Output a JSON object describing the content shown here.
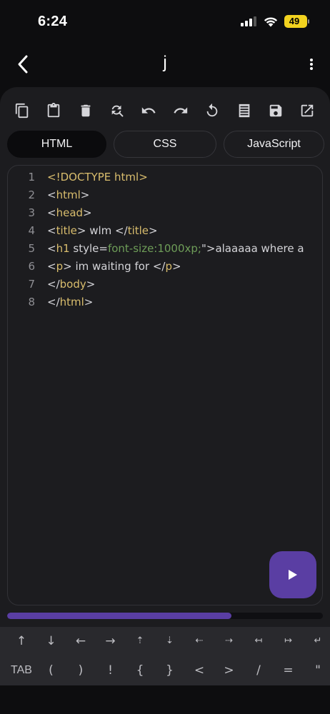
{
  "status_bar": {
    "time": "6:24",
    "battery": "49"
  },
  "header": {
    "title": "j"
  },
  "toolbar": {
    "icons": [
      "copy-icon",
      "paste-icon",
      "delete-icon",
      "find-replace-icon",
      "undo-icon",
      "redo-icon",
      "reload-icon",
      "format-icon",
      "save-icon",
      "open-external-icon"
    ]
  },
  "tabs": [
    {
      "label": "HTML",
      "active": true
    },
    {
      "label": "CSS",
      "active": false
    },
    {
      "label": "JavaScript",
      "active": false
    }
  ],
  "editor": {
    "lines": [
      {
        "n": "1",
        "tokens": [
          {
            "t": "<!DOCTYPE html>",
            "c": "y"
          }
        ]
      },
      {
        "n": "2",
        "tokens": [
          {
            "t": "<",
            "c": "w"
          },
          {
            "t": "html",
            "c": "y"
          },
          {
            "t": ">",
            "c": "w"
          }
        ]
      },
      {
        "n": "3",
        "tokens": [
          {
            "t": "<",
            "c": "w"
          },
          {
            "t": "head",
            "c": "y"
          },
          {
            "t": ">",
            "c": "w"
          }
        ]
      },
      {
        "n": "4",
        "tokens": [
          {
            "t": "<",
            "c": "w"
          },
          {
            "t": "title",
            "c": "y"
          },
          {
            "t": "> wlm </",
            "c": "w"
          },
          {
            "t": "title",
            "c": "y"
          },
          {
            "t": ">",
            "c": "w"
          }
        ]
      },
      {
        "n": "5",
        "tokens": [
          {
            "t": "<",
            "c": "w"
          },
          {
            "t": "h1",
            "c": "y"
          },
          {
            "t": " style=",
            "c": "w"
          },
          {
            "t": "font-size:1000xp;",
            "c": "g"
          },
          {
            "t": "\">alaaaaa where a",
            "c": "w"
          }
        ]
      },
      {
        "n": "6",
        "tokens": [
          {
            "t": "<",
            "c": "w"
          },
          {
            "t": "p",
            "c": "y"
          },
          {
            "t": "> im waiting for </",
            "c": "w"
          },
          {
            "t": "p",
            "c": "y"
          },
          {
            "t": ">",
            "c": "w"
          }
        ]
      },
      {
        "n": "7",
        "tokens": [
          {
            "t": "</",
            "c": "w"
          },
          {
            "t": "body",
            "c": "y"
          },
          {
            "t": ">",
            "c": "w"
          }
        ]
      },
      {
        "n": "8",
        "tokens": [
          {
            "t": "</",
            "c": "w"
          },
          {
            "t": "html",
            "c": "y"
          },
          {
            "t": ">",
            "c": "w"
          }
        ]
      }
    ]
  },
  "progress": {
    "value": 0.71
  },
  "accessory": {
    "row1": [
      "↑",
      "↓",
      "←",
      "→",
      "⇡",
      "⇣",
      "⇠",
      "⇢",
      "↤",
      "↦",
      "↵"
    ],
    "row2": [
      "TAB",
      "(",
      ")",
      "!",
      "{",
      "}",
      "<",
      ">",
      "/",
      "=",
      "\""
    ]
  },
  "colors": {
    "accent": "#5a3ea3",
    "battery": "#f2d21f",
    "keyword": "#d9bd6d",
    "string": "#6e9d58"
  }
}
